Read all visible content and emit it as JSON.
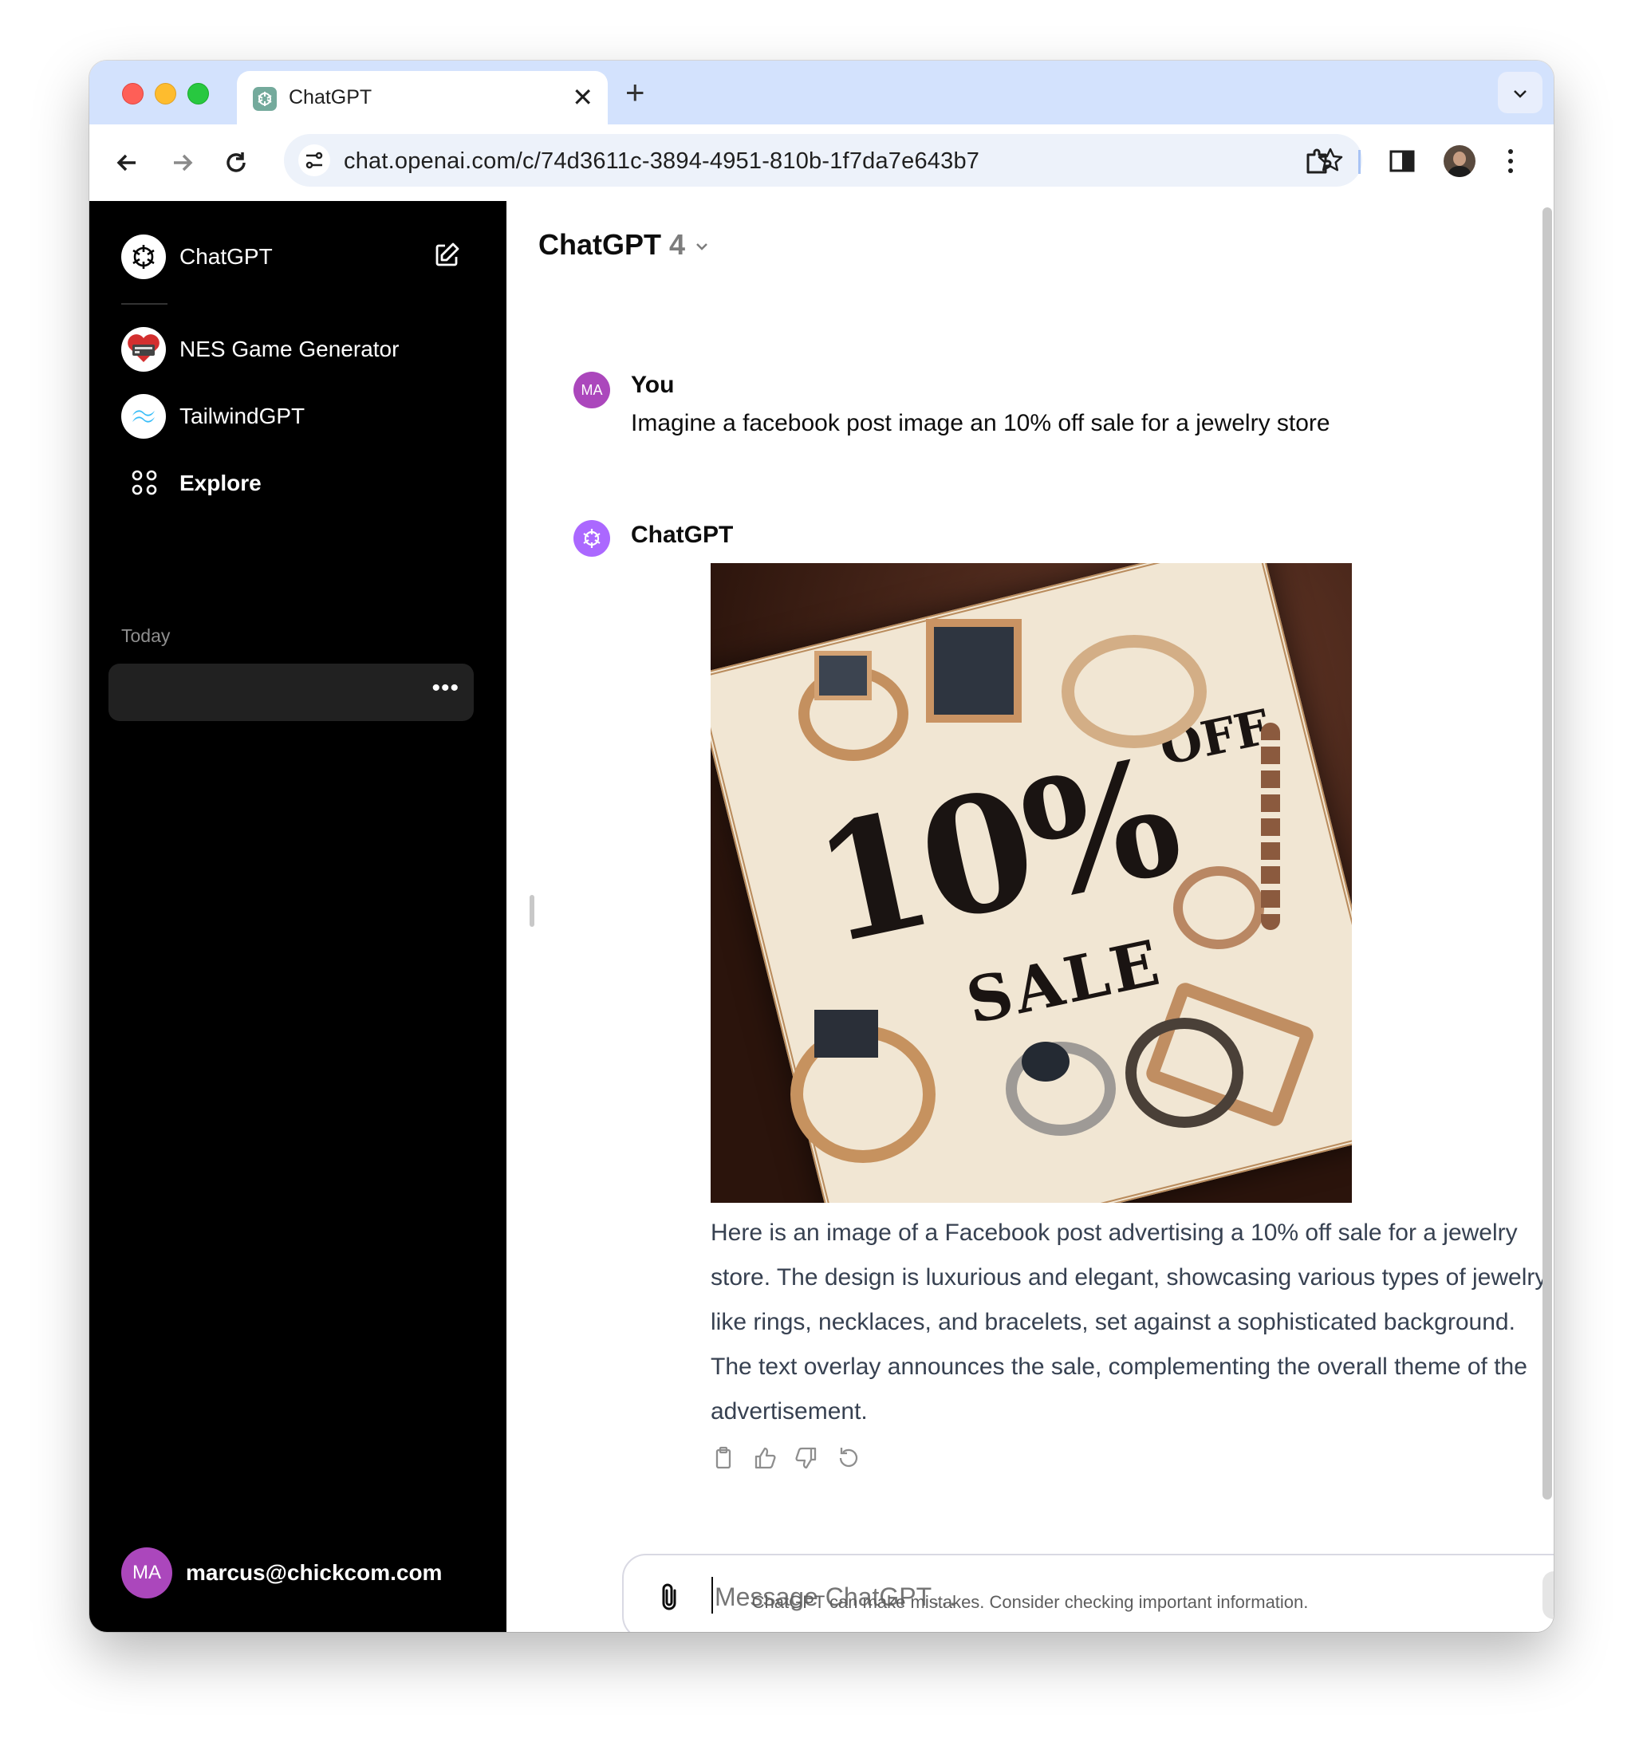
{
  "browser": {
    "tab_title": "ChatGPT",
    "new_tab_symbol": "+",
    "url": "chat.openai.com/c/74d3611c-3894-4951-810b-1f7da7e643b7"
  },
  "sidebar": {
    "brand": "ChatGPT",
    "gpts": [
      {
        "label": "NES Game Generator",
        "icon": "nes-game-icon"
      },
      {
        "label": "TailwindGPT",
        "icon": "tailwind-icon"
      },
      {
        "label": "Explore",
        "icon": "grid-icon"
      }
    ],
    "section_today": "Today",
    "chat_options": "•••",
    "user": {
      "initials": "MA",
      "email": "marcus@chickcom.com"
    }
  },
  "header": {
    "model_name": "ChatGPT",
    "model_version": "4"
  },
  "conversation": {
    "user": {
      "initials": "MA",
      "name": "You",
      "text": "Imagine a facebook post image an 10% off sale for a jewelry store"
    },
    "assistant": {
      "name": "ChatGPT",
      "image": {
        "big": "10%",
        "off": "OFF",
        "sale": "SALE"
      },
      "text": "Here is an image of a Facebook post advertising a 10% off sale for a jewelry store. The design is luxurious and elegant, showcasing various types of jewelry like rings, necklaces, and bracelets, set against a sophisticated background. The text overlay announces the sale, complementing the overall theme of the advertisement."
    }
  },
  "composer": {
    "placeholder": "Message ChatGPT…",
    "disclaimer": "ChatGPT can make mistakes. Consider checking important information."
  },
  "colors": {
    "sidebar_bg": "#000000",
    "avatar_purple": "#ab47bc",
    "tab_strip": "#d3e2fd",
    "omnibox": "#edf2fa"
  }
}
